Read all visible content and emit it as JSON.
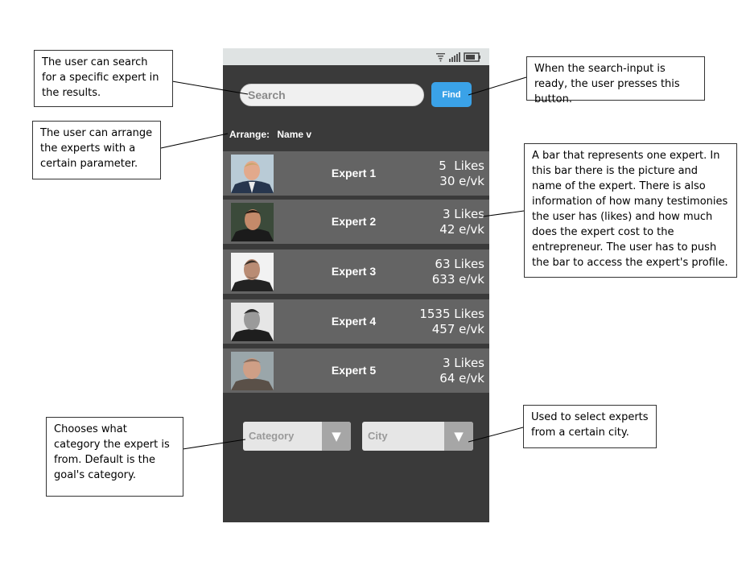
{
  "search": {
    "placeholder": "Search",
    "button_label": "Find"
  },
  "arrange": {
    "label": "Arrange:",
    "value": "Name v"
  },
  "experts": [
    {
      "name": "Expert 1",
      "likes": "5  Likes",
      "cost": "30 e/vk",
      "photo": "portrait-photo-1"
    },
    {
      "name": "Expert 2",
      "likes": "3 Likes",
      "cost": "42 e/vk",
      "photo": "portrait-photo-2"
    },
    {
      "name": "Expert 3",
      "likes": "63 Likes",
      "cost": "633 e/vk",
      "photo": "portrait-photo-3"
    },
    {
      "name": "Expert 4",
      "likes": "1535 Likes",
      "cost": "457 e/vk",
      "photo": "portrait-photo-4"
    },
    {
      "name": "Expert 5",
      "likes": "3 Likes",
      "cost": "64 e/vk",
      "photo": "portrait-photo-5"
    }
  ],
  "filters": {
    "category_label": "Category",
    "city_label": "City"
  },
  "icons": {
    "wifi": "wifi-icon",
    "signal": "signal-icon",
    "battery": "battery-icon",
    "dropdown": "triangle-down-icon"
  },
  "colors": {
    "phone_background": "#3a3a3a",
    "expert_row": "#646464",
    "find_button": "#3aa2e8",
    "status_bar": "#dfe3e3"
  },
  "annotations": {
    "search": "The user can search for a specific expert in the results.",
    "find": "When the search-input is ready, the user presses this button.",
    "arrange": "The user can arrange the experts with a certain parameter.",
    "expert_bar": "A bar that represents one expert. In this bar there is the picture and name of the expert. There is also information of how many testimonies the user has (likes) and how much does the expert cost to the entrepreneur. The user has to push the bar to access the expert's profile.",
    "category": "Chooses what category the expert is from. Default is the goal's category.",
    "city": "Used to select experts from a certain city."
  }
}
